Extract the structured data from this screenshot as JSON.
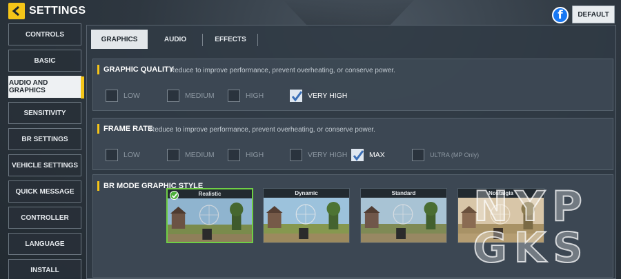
{
  "header": {
    "title": "SETTINGS",
    "back_icon": "back-arrow-icon",
    "default_label": "DEFAULT",
    "facebook_icon": "facebook-icon",
    "facebook_glyph": "f"
  },
  "sidebar": {
    "items": [
      {
        "label": "CONTROLS"
      },
      {
        "label": "BASIC"
      },
      {
        "label": "AUDIO AND GRAPHICS",
        "active": true
      },
      {
        "label": "SENSITIVITY"
      },
      {
        "label": "BR SETTINGS"
      },
      {
        "label": "VEHICLE SETTINGS"
      },
      {
        "label": "QUICK MESSAGE"
      },
      {
        "label": "CONTROLLER"
      },
      {
        "label": "LANGUAGE"
      },
      {
        "label": "INSTALL"
      }
    ]
  },
  "tabs": [
    {
      "label": "GRAPHICS",
      "active": true
    },
    {
      "label": "AUDIO"
    },
    {
      "label": "EFFECTS"
    }
  ],
  "graphic_quality": {
    "title": "GRAPHIC QUALITY",
    "description": "Reduce to improve performance, prevent overheating, or conserve power.",
    "options": [
      {
        "label": "LOW",
        "checked": false
      },
      {
        "label": "MEDIUM",
        "checked": false
      },
      {
        "label": "HIGH",
        "checked": false
      },
      {
        "label": "VERY HIGH",
        "checked": true
      }
    ]
  },
  "frame_rate": {
    "title": "FRAME RATE",
    "description": "Reduce to improve performance, prevent overheating, or conserve power.",
    "options": [
      {
        "label": "LOW",
        "checked": false
      },
      {
        "label": "MEDIUM",
        "checked": false
      },
      {
        "label": "HIGH",
        "checked": false
      },
      {
        "label": "VERY HIGH",
        "checked": false
      },
      {
        "label": "MAX",
        "checked": true
      },
      {
        "label": "ULTRA (MP Only)",
        "checked": false
      }
    ]
  },
  "br_mode": {
    "title": "BR MODE GRAPHIC STYLE",
    "styles": [
      {
        "label": "Realistic",
        "selected": true
      },
      {
        "label": "Dynamic",
        "selected": false
      },
      {
        "label": "Standard",
        "selected": false
      },
      {
        "label": "Nostalgia",
        "selected": false
      }
    ]
  },
  "watermark": {
    "line1": "NYP",
    "line2": "GKS"
  },
  "colors": {
    "accent": "#f5c518",
    "selected_border": "#6fcf45",
    "facebook": "#1877f2"
  }
}
